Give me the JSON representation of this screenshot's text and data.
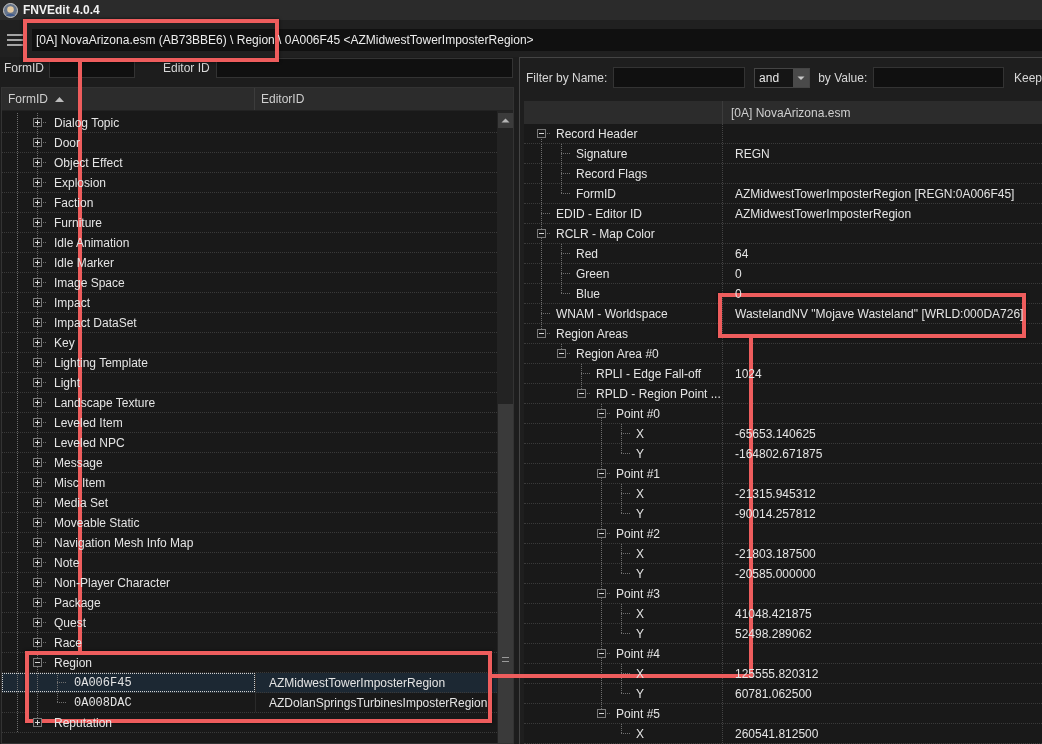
{
  "window": {
    "title": "FNVEdit 4.0.4"
  },
  "path_bar": {
    "text": "[0A] NovaArizona.esm (AB73BBE6) \\ Region \\ 0A006F45 <AZMidwestTowerImposterRegion>",
    "highlighted": true
  },
  "navigator": {
    "filters": [
      {
        "label": "FormID"
      },
      {
        "label": "Editor ID"
      }
    ],
    "columns": [
      {
        "label": "FormID",
        "sorted_ascending": true
      },
      {
        "label": "EditorID",
        "sorted_ascending": false
      }
    ],
    "items": [
      {
        "label": "Dialog Topic",
        "expanded": false,
        "highlighted": false
      },
      {
        "label": "Door",
        "expanded": false,
        "highlighted": false
      },
      {
        "label": "Object Effect",
        "expanded": false,
        "highlighted": false
      },
      {
        "label": "Explosion",
        "expanded": false,
        "highlighted": false
      },
      {
        "label": "Faction",
        "expanded": false,
        "highlighted": false
      },
      {
        "label": "Furniture",
        "expanded": false,
        "highlighted": false
      },
      {
        "label": "Idle Animation",
        "expanded": false,
        "highlighted": false
      },
      {
        "label": "Idle Marker",
        "expanded": false,
        "highlighted": false
      },
      {
        "label": "Image Space",
        "expanded": false,
        "highlighted": false
      },
      {
        "label": "Impact",
        "expanded": false,
        "highlighted": false
      },
      {
        "label": "Impact DataSet",
        "expanded": false,
        "highlighted": false
      },
      {
        "label": "Key",
        "expanded": false,
        "highlighted": false
      },
      {
        "label": "Lighting Template",
        "expanded": false,
        "highlighted": false
      },
      {
        "label": "Light",
        "expanded": false,
        "highlighted": false
      },
      {
        "label": "Landscape Texture",
        "expanded": false,
        "highlighted": false
      },
      {
        "label": "Leveled Item",
        "expanded": false,
        "highlighted": false
      },
      {
        "label": "Leveled NPC",
        "expanded": false,
        "highlighted": false
      },
      {
        "label": "Message",
        "expanded": false,
        "highlighted": false
      },
      {
        "label": "Misc Item",
        "expanded": false,
        "highlighted": false
      },
      {
        "label": "Media Set",
        "expanded": false,
        "highlighted": false
      },
      {
        "label": "Moveable Static",
        "expanded": false,
        "highlighted": false
      },
      {
        "label": "Navigation Mesh Info Map",
        "expanded": false,
        "highlighted": false
      },
      {
        "label": "Note",
        "expanded": false,
        "highlighted": false
      },
      {
        "label": "Non-Player Character",
        "expanded": false,
        "highlighted": false
      },
      {
        "label": "Package",
        "expanded": false,
        "highlighted": false
      },
      {
        "label": "Quest",
        "expanded": false,
        "highlighted": false
      },
      {
        "label": "Race",
        "expanded": false,
        "highlighted": false
      },
      {
        "label": "Region",
        "expanded": true,
        "highlighted": true,
        "children": [
          {
            "form_id": "0A006F45",
            "editor_id": "AZMidwestTowerImposterRegion",
            "selected": true
          },
          {
            "form_id": "0A008DAC",
            "editor_id": "AZDolanSpringsTurbinesImposterRegion",
            "selected": false
          }
        ]
      },
      {
        "label": "Reputation",
        "expanded": false,
        "highlighted": false
      }
    ]
  },
  "record_view": {
    "filter": {
      "name_label": "Filter by Name:",
      "operator": "and",
      "value_label": "by Value:",
      "keep_label": "Keep"
    },
    "column_header": "[0A] NovaArizona.esm",
    "rows": [
      {
        "label": "Record Header",
        "expanded": true,
        "highlighted": false,
        "children": [
          {
            "label": "Signature",
            "value": "REGN"
          },
          {
            "label": "Record Flags"
          },
          {
            "label": "FormID",
            "value": "AZMidwestTowerImposterRegion [REGN:0A006F45]"
          }
        ]
      },
      {
        "label": "EDID - Editor ID",
        "value": "AZMidwestTowerImposterRegion",
        "highlighted": false
      },
      {
        "label": "RCLR - Map Color",
        "expanded": true,
        "highlighted": false,
        "children": [
          {
            "label": "Red",
            "value": "64"
          },
          {
            "label": "Green",
            "value": "0"
          },
          {
            "label": "Blue",
            "value": "0"
          }
        ]
      },
      {
        "label": "WNAM - Worldspace",
        "value": "WastelandNV \"Mojave Wasteland\" [WRLD:000DA726]",
        "highlighted": true
      },
      {
        "label": "Region Areas",
        "expanded": true,
        "highlighted": false,
        "children": [
          {
            "label": "Region Area #0",
            "expanded": true,
            "children": [
              {
                "label": "RPLI - Edge Fall-off",
                "value": "1024"
              },
              {
                "label": "RPLD - Region Point ...",
                "expanded": true,
                "children": [
                  {
                    "label": "Point #0",
                    "expanded": true,
                    "children": [
                      {
                        "label": "X",
                        "value": "-65653.140625"
                      },
                      {
                        "label": "Y",
                        "value": "-164802.671875"
                      }
                    ]
                  },
                  {
                    "label": "Point #1",
                    "expanded": true,
                    "children": [
                      {
                        "label": "X",
                        "value": "-21315.945312"
                      },
                      {
                        "label": "Y",
                        "value": "-90014.257812"
                      }
                    ]
                  },
                  {
                    "label": "Point #2",
                    "expanded": true,
                    "children": [
                      {
                        "label": "X",
                        "value": "-21803.187500"
                      },
                      {
                        "label": "Y",
                        "value": "-20585.000000"
                      }
                    ]
                  },
                  {
                    "label": "Point #3",
                    "expanded": true,
                    "children": [
                      {
                        "label": "X",
                        "value": "41048.421875"
                      },
                      {
                        "label": "Y",
                        "value": "52498.289062"
                      }
                    ]
                  },
                  {
                    "label": "Point #4",
                    "expanded": true,
                    "children": [
                      {
                        "label": "X",
                        "value": "125555.820312"
                      },
                      {
                        "label": "Y",
                        "value": "60781.062500"
                      }
                    ]
                  },
                  {
                    "label": "Point #5",
                    "expanded": true,
                    "children": [
                      {
                        "label": "X",
                        "value": "260541.812500"
                      }
                    ]
                  }
                ]
              }
            ]
          }
        ]
      }
    ]
  }
}
